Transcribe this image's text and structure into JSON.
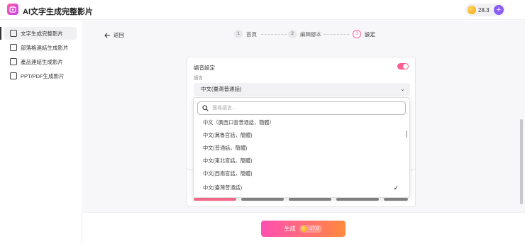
{
  "app": {
    "title": "AI文字生成完整影片"
  },
  "header": {
    "credits": "28.3",
    "add_icon": "plus-icon"
  },
  "sidebar": {
    "items": [
      {
        "label": "文字生成完整影片",
        "icon": "text-video-icon",
        "active": true
      },
      {
        "label": "部落格連結生成影片",
        "icon": "blog-link-icon",
        "active": false
      },
      {
        "label": "產品連結生成影片",
        "icon": "product-link-icon",
        "active": false
      },
      {
        "label": "PPT/PDF生成影片",
        "icon": "document-icon",
        "active": false
      }
    ]
  },
  "nav": {
    "back_label": "返回"
  },
  "steps": [
    {
      "num": "1",
      "label": "首頁",
      "active": false
    },
    {
      "num": "2",
      "label": "編輯腳本",
      "active": false
    },
    {
      "num": "3",
      "label": "設定",
      "active": true
    }
  ],
  "voice": {
    "title": "語音設定",
    "enabled": true,
    "language_label": "語言",
    "selected_language": "中文(臺灣普通話)"
  },
  "dropdown": {
    "search_placeholder": "搜尋語言...",
    "options": [
      {
        "label": "中文（廣西口音普通話，簡體）",
        "selected": false
      },
      {
        "label": "中文(冀魯官話，簡體)",
        "selected": false
      },
      {
        "label": "中文(普通話，簡體)",
        "selected": false
      },
      {
        "label": "中文(東北官話，簡體)",
        "selected": false
      },
      {
        "label": "中文(西南官話，簡體)",
        "selected": false
      },
      {
        "label": "中文(臺灣普通話)",
        "selected": true
      }
    ]
  },
  "footer": {
    "generate_label": "生成",
    "cost": "-17.9"
  },
  "colors": {
    "accent_pink": "#ff5d8f",
    "gradient_start": "#ff4fb4",
    "gradient_end": "#ff8a3d",
    "purple": "#8b5cf6"
  }
}
